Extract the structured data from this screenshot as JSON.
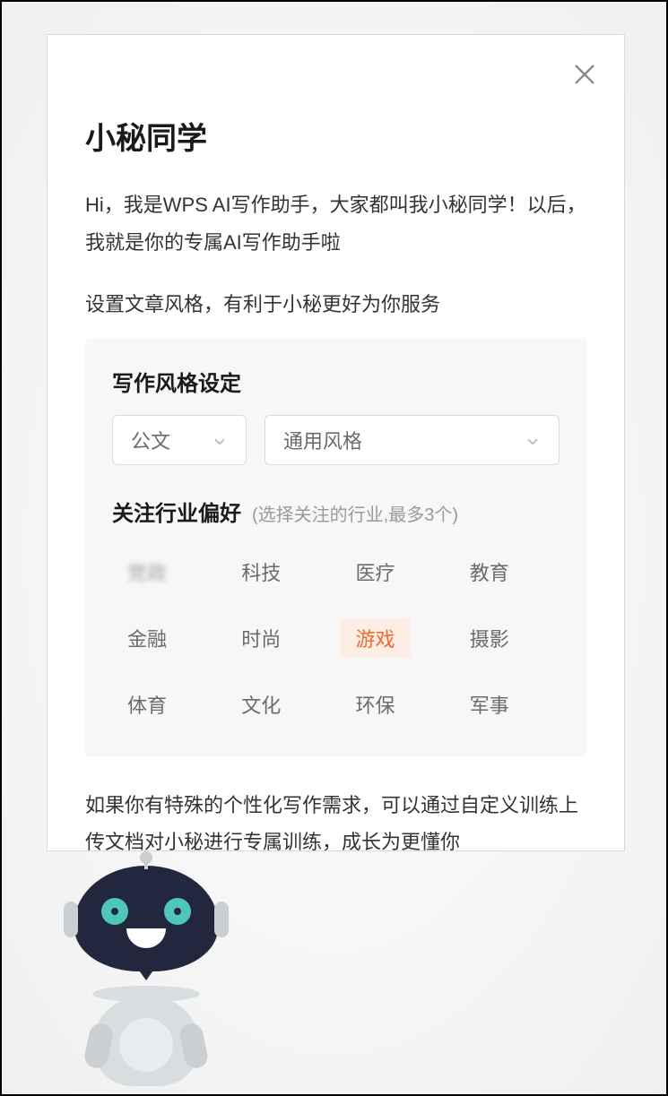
{
  "title": "小秘同学",
  "intro": "Hi，我是WPS AI写作助手，大家都叫我小秘同学！以后，我就是你的专属AI写作助手啦",
  "subtip": "设置文章风格，有利于小秘更好为你服务",
  "style_section": {
    "heading": "写作风格设定",
    "category_select": "公文",
    "style_select": "通用风格"
  },
  "pref_section": {
    "label": "关注行业偏好",
    "hint": "(选择关注的行业,最多3个)",
    "tags": [
      {
        "label": "党政",
        "selected": false,
        "blurred": true
      },
      {
        "label": "科技",
        "selected": false,
        "blurred": false
      },
      {
        "label": "医疗",
        "selected": false,
        "blurred": false
      },
      {
        "label": "教育",
        "selected": false,
        "blurred": false
      },
      {
        "label": "金融",
        "selected": false,
        "blurred": false
      },
      {
        "label": "时尚",
        "selected": false,
        "blurred": false
      },
      {
        "label": "游戏",
        "selected": true,
        "blurred": false
      },
      {
        "label": "摄影",
        "selected": false,
        "blurred": false
      },
      {
        "label": "体育",
        "selected": false,
        "blurred": false
      },
      {
        "label": "文化",
        "selected": false,
        "blurred": false
      },
      {
        "label": "环保",
        "selected": false,
        "blurred": false
      },
      {
        "label": "军事",
        "selected": false,
        "blurred": false
      }
    ]
  },
  "footer_text": "如果你有特殊的个性化写作需求，可以通过自定义训练上传文档对小秘进行专属训练，成长为更懂你"
}
